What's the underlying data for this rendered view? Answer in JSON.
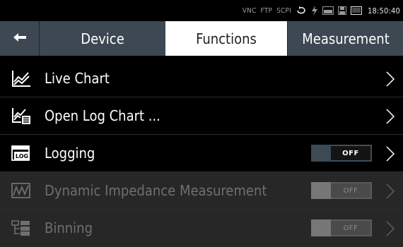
{
  "status": {
    "items": [
      "VNC",
      "FTP",
      "SCPI"
    ],
    "time": "18:50:40",
    "icons": [
      "sync-icon",
      "lightning-icon",
      "log-icon",
      "save-icon",
      "screen-icon"
    ]
  },
  "tabs": {
    "back_icon": "arrow-left-icon",
    "device": "Device",
    "functions": "Functions",
    "measurement": "Measurement",
    "active": "Functions"
  },
  "rows": [
    {
      "label": "Live Chart",
      "icon": "line-chart-icon",
      "enabled": true
    },
    {
      "label": "Open Log Chart ...",
      "icon": "open-log-chart-icon",
      "enabled": true
    },
    {
      "label": "Logging",
      "icon": "log-icon",
      "enabled": true,
      "toggle": "OFF"
    },
    {
      "label": "Dynamic Impedance Measurement",
      "icon": "impedance-icon",
      "enabled": false,
      "toggle": "OFF"
    },
    {
      "label": "Binning",
      "icon": "binning-icon",
      "enabled": false,
      "toggle": "OFF"
    }
  ],
  "colors": {
    "tab_bar": "#3d4852",
    "active_tab": "#ffffff",
    "toggle_off": "#141414"
  }
}
